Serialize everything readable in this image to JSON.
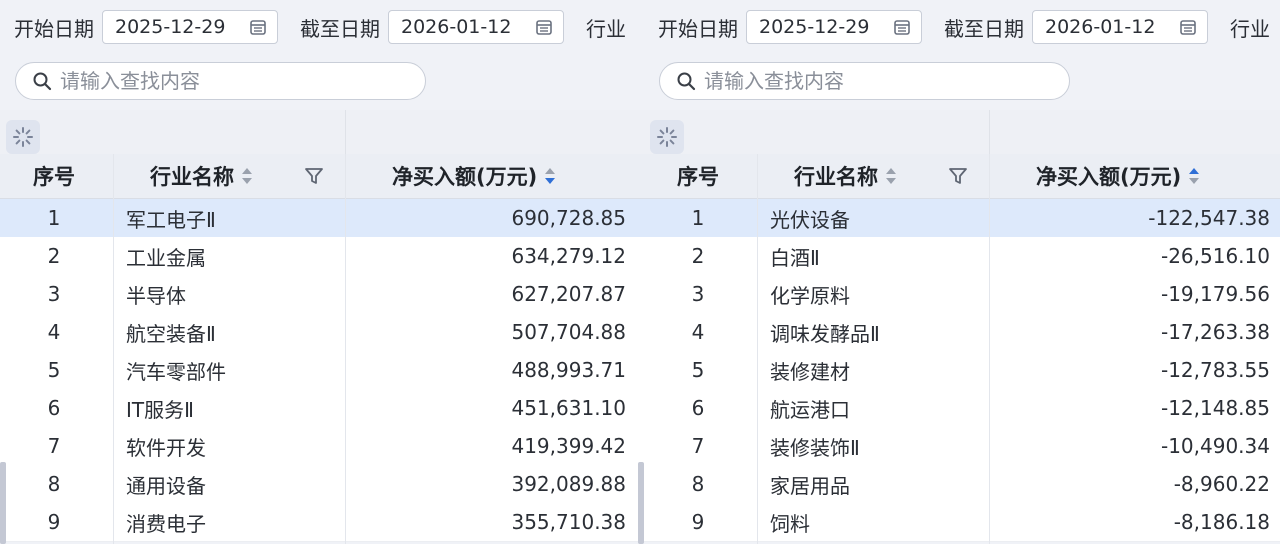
{
  "panels": [
    {
      "filters": {
        "start_label": "开始日期",
        "start_value": "2025-12-29",
        "end_label": "截至日期",
        "end_value": "2026-01-12",
        "industry_label": "行业"
      },
      "search": {
        "placeholder": "请输入查找内容"
      },
      "columns": {
        "index": "序号",
        "name": "行业名称",
        "amount": "净买入额(万元)"
      },
      "rows": [
        {
          "index": "1",
          "name": "军工电子Ⅱ",
          "amount": "690,728.85"
        },
        {
          "index": "2",
          "name": "工业金属",
          "amount": "634,279.12"
        },
        {
          "index": "3",
          "name": "半导体",
          "amount": "627,207.87"
        },
        {
          "index": "4",
          "name": "航空装备Ⅱ",
          "amount": "507,704.88"
        },
        {
          "index": "5",
          "name": "汽车零部件",
          "amount": "488,993.71"
        },
        {
          "index": "6",
          "name": "IT服务Ⅱ",
          "amount": "451,631.10"
        },
        {
          "index": "7",
          "name": "软件开发",
          "amount": "419,399.42"
        },
        {
          "index": "8",
          "name": "通用设备",
          "amount": "392,089.88"
        },
        {
          "index": "9",
          "name": "消费电子",
          "amount": "355,710.38"
        }
      ],
      "sort_direction": "desc"
    },
    {
      "filters": {
        "start_label": "开始日期",
        "start_value": "2025-12-29",
        "end_label": "截至日期",
        "end_value": "2026-01-12",
        "industry_label": "行业"
      },
      "search": {
        "placeholder": "请输入查找内容"
      },
      "columns": {
        "index": "序号",
        "name": "行业名称",
        "amount": "净买入额(万元)"
      },
      "rows": [
        {
          "index": "1",
          "name": "光伏设备",
          "amount": "-122,547.38"
        },
        {
          "index": "2",
          "name": "白酒Ⅱ",
          "amount": "-26,516.10"
        },
        {
          "index": "3",
          "name": "化学原料",
          "amount": "-19,179.56"
        },
        {
          "index": "4",
          "name": "调味发酵品Ⅱ",
          "amount": "-17,263.38"
        },
        {
          "index": "5",
          "name": "装修建材",
          "amount": "-12,783.55"
        },
        {
          "index": "6",
          "name": "航运港口",
          "amount": "-12,148.85"
        },
        {
          "index": "7",
          "name": "装修装饰Ⅱ",
          "amount": "-10,490.34"
        },
        {
          "index": "8",
          "name": "家居用品",
          "amount": "-8,960.22"
        },
        {
          "index": "9",
          "name": "饲料",
          "amount": "-8,186.18"
        }
      ],
      "sort_direction": "asc"
    }
  ],
  "icons": {
    "calendar": "calendar-icon",
    "search": "search-icon",
    "loader": "loading-spinner-icon",
    "sort": "sort-icon",
    "filter": "filter-icon"
  },
  "colors": {
    "accent": "#2f6fd6",
    "selected_row": "#dde9fb",
    "header_bg": "#ebeef4",
    "page_bg": "#f0f2f7"
  }
}
